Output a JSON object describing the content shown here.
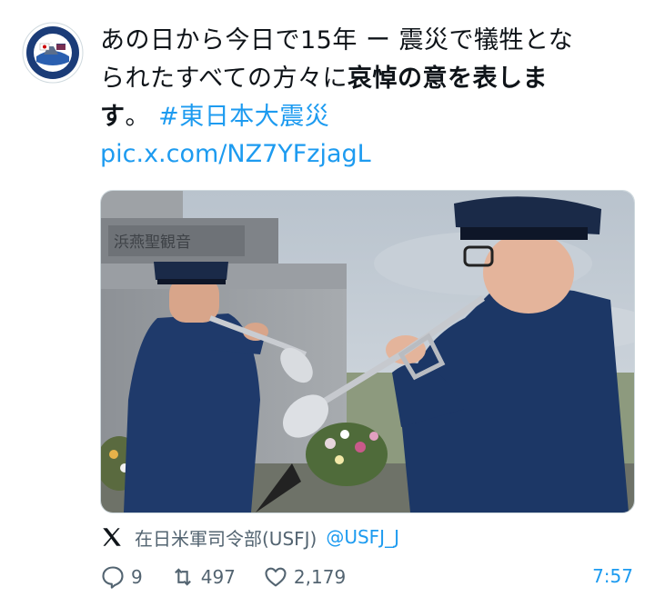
{
  "post": {
    "text_line1": "あの日から今日で15年 ー 震災で犠牲とな",
    "text_line2_plain": "られたすべての方々に",
    "text_line2_bold": "哀悼の意を表しま",
    "text_line3_bold": "す",
    "text_line3_plain": "。 ",
    "hashtag": "#東日本大震災",
    "media_link": "pic.x.com/NZ7YFzjagL",
    "media_alt_icon": "memorial-trumpeters-photo"
  },
  "source": {
    "icon": "x-logo-icon",
    "account_name": "在日米軍司令部(USFJ)",
    "handle": "@USFJ_J"
  },
  "stats": {
    "replies": "9",
    "reposts": "497",
    "likes": "2,179",
    "time": "7:57"
  },
  "colors": {
    "link": "#1d9bf0",
    "muted": "#536471",
    "text": "#0f1419",
    "uniform": "#1f3a6b"
  }
}
